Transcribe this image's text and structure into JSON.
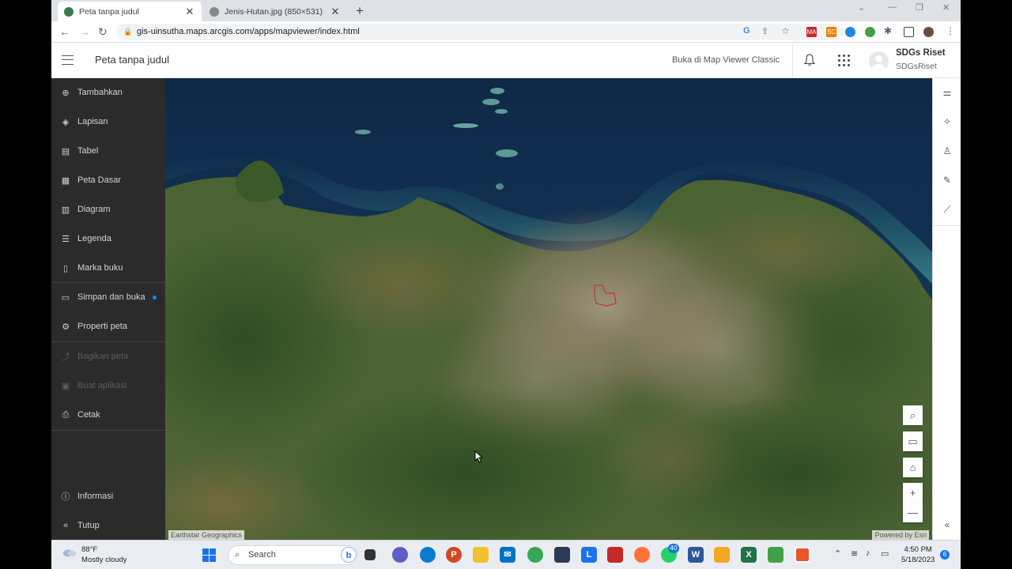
{
  "browser": {
    "tabs": [
      {
        "title": "Peta tanpa judul",
        "active": true
      },
      {
        "title": "Jenis-Hutan.jpg (850×531)",
        "active": false
      }
    ],
    "url": "gis-uinsutha.maps.arcgis.com/apps/mapviewer/index.html",
    "extensions": [
      "MA",
      "SC"
    ]
  },
  "app": {
    "map_title": "Peta tanpa judul",
    "classic_link": "Buka di Map Viewer Classic",
    "user": {
      "name": "SDGs Riset",
      "login": "SDGsRiset"
    }
  },
  "sidebar": {
    "items": [
      {
        "label": "Tambahkan",
        "icon": "plus-circle-icon"
      },
      {
        "label": "Lapisan",
        "icon": "layers-icon"
      },
      {
        "label": "Tabel",
        "icon": "table-icon"
      },
      {
        "label": "Peta Dasar",
        "icon": "basemap-icon"
      },
      {
        "label": "Diagram",
        "icon": "chart-icon"
      },
      {
        "label": "Legenda",
        "icon": "legend-icon"
      },
      {
        "label": "Marka buku",
        "icon": "bookmark-icon"
      },
      {
        "label": "Simpan dan buka",
        "icon": "folder-icon"
      },
      {
        "label": "Properti peta",
        "icon": "gear-icon"
      },
      {
        "label": "Bagikan peta",
        "icon": "share-icon"
      },
      {
        "label": "Buat aplikasi",
        "icon": "apps-icon"
      },
      {
        "label": "Cetak",
        "icon": "print-icon"
      }
    ],
    "bottom": [
      {
        "label": "Informasi",
        "icon": "info-icon"
      },
      {
        "label": "Tutup",
        "icon": "collapse-icon"
      }
    ]
  },
  "map": {
    "attribution_left": "Earthstar Geographics",
    "attribution_right": "Powered by Esri",
    "controls": [
      "search-icon",
      "fullscreen-icon",
      "home-icon",
      "zoom-in-icon",
      "zoom-out-icon"
    ]
  },
  "right_toolbar": {
    "tools": [
      "properties-icon",
      "effects-icon",
      "styles-icon",
      "sketch-icon",
      "measure-icon"
    ],
    "collapse": "«"
  },
  "taskbar": {
    "weather": {
      "temp": "88°F",
      "desc": "Mostly cloudy"
    },
    "search_placeholder": "Search",
    "badge_count": "40",
    "time": "4:50 PM",
    "date": "5/18/2023",
    "notification_count": "6"
  }
}
